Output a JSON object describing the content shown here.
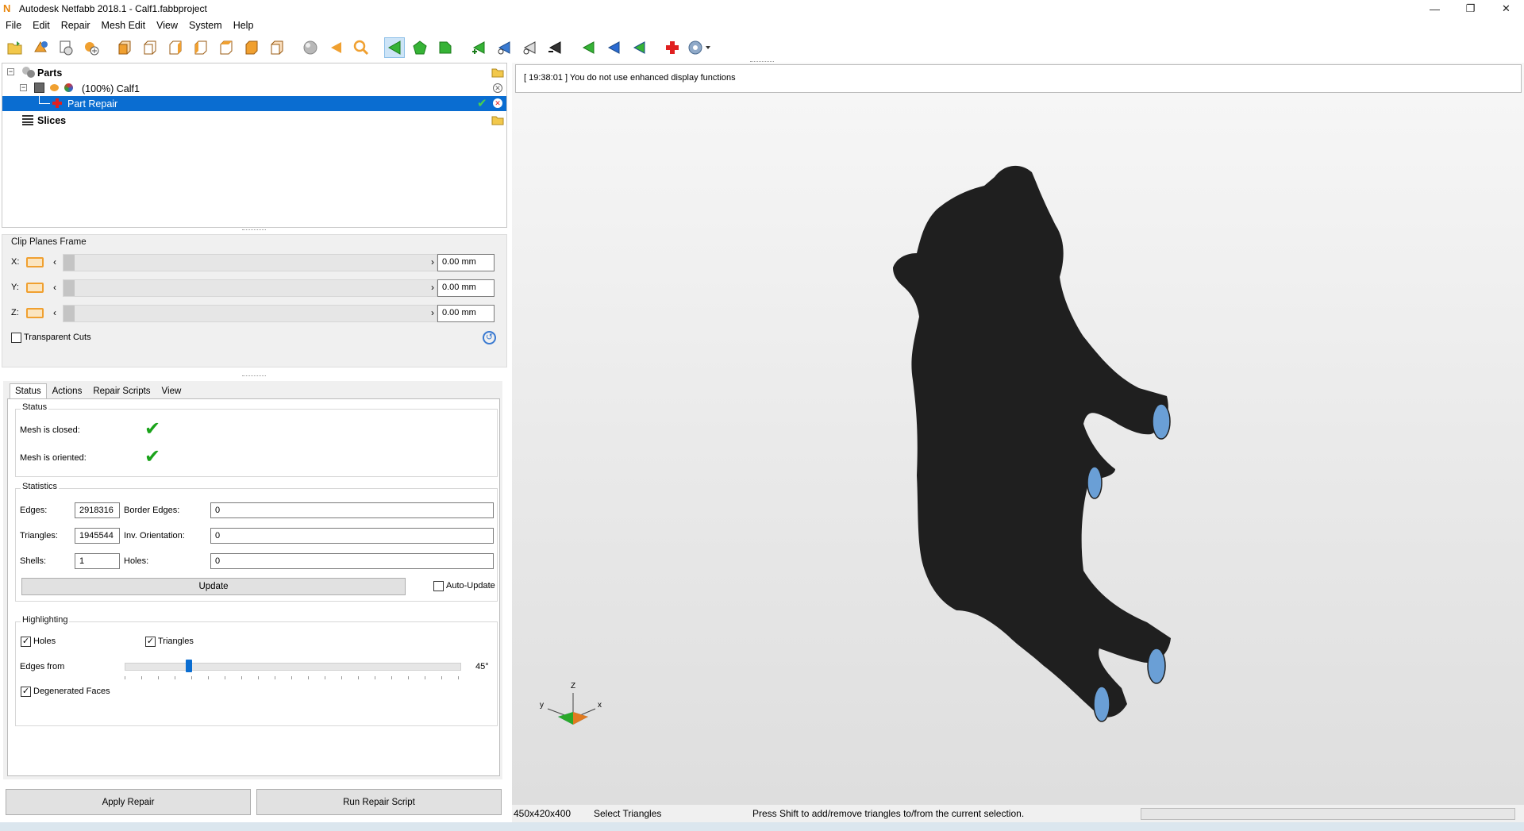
{
  "window": {
    "title": "Autodesk Netfabb 2018.1 - Calf1.fabbproject",
    "logo_letter": "N"
  },
  "menu": [
    "File",
    "Edit",
    "Repair",
    "Mesh Edit",
    "View",
    "System",
    "Help"
  ],
  "tree": {
    "parts_label": "Parts",
    "part_label": "(100%) Calf1",
    "repair_label": "Part Repair",
    "slices_label": "Slices"
  },
  "clip_planes": {
    "title": "Clip Planes Frame",
    "axes": [
      {
        "label": "X:",
        "value": "0.00 mm"
      },
      {
        "label": "Y:",
        "value": "0.00 mm"
      },
      {
        "label": "Z:",
        "value": "0.00 mm"
      }
    ],
    "transparent_cuts_label": "Transparent Cuts",
    "transparent_cuts_checked": false
  },
  "tabs": [
    "Status",
    "Actions",
    "Repair Scripts",
    "View"
  ],
  "status": {
    "group_title": "Status",
    "mesh_closed_label": "Mesh is closed:",
    "mesh_oriented_label": "Mesh is oriented:"
  },
  "statistics": {
    "group_title": "Statistics",
    "edges_label": "Edges:",
    "edges_value": "2918316",
    "border_edges_label": "Border Edges:",
    "border_edges_value": "0",
    "triangles_label": "Triangles:",
    "triangles_value": "1945544",
    "inv_orientation_label": "Inv. Orientation:",
    "inv_orientation_value": "0",
    "shells_label": "Shells:",
    "shells_value": "1",
    "holes_label": "Holes:",
    "holes_value": "0",
    "update_label": "Update",
    "auto_update_label": "Auto-Update",
    "auto_update_checked": false
  },
  "highlighting": {
    "group_title": "Highlighting",
    "holes_label": "Holes",
    "holes_checked": true,
    "triangles_label": "Triangles",
    "triangles_checked": true,
    "edges_from_label": "Edges from",
    "edges_from_value": "45°",
    "edges_from_fraction": 0.19,
    "degenerated_label": "Degenerated Faces",
    "degenerated_checked": true
  },
  "buttons": {
    "apply_repair": "Apply Repair",
    "run_repair_script": "Run Repair Script"
  },
  "viewport": {
    "message": "[ 19:38:01 ] You do not use enhanced display functions",
    "axis_z": "Z",
    "axis_y": "y",
    "axis_x": "x",
    "model_color": "#1f1f1f",
    "hoof_color": "#6a9fd6"
  },
  "statusbar": {
    "dimensions": "450x420x400",
    "mode": "Select Triangles",
    "hint": "Press Shift to add/remove triangles to/from the current selection."
  },
  "colors": {
    "selection": "#0a6dd1",
    "check_green": "#1aa31a",
    "swatch_orange": "#f0a030"
  }
}
